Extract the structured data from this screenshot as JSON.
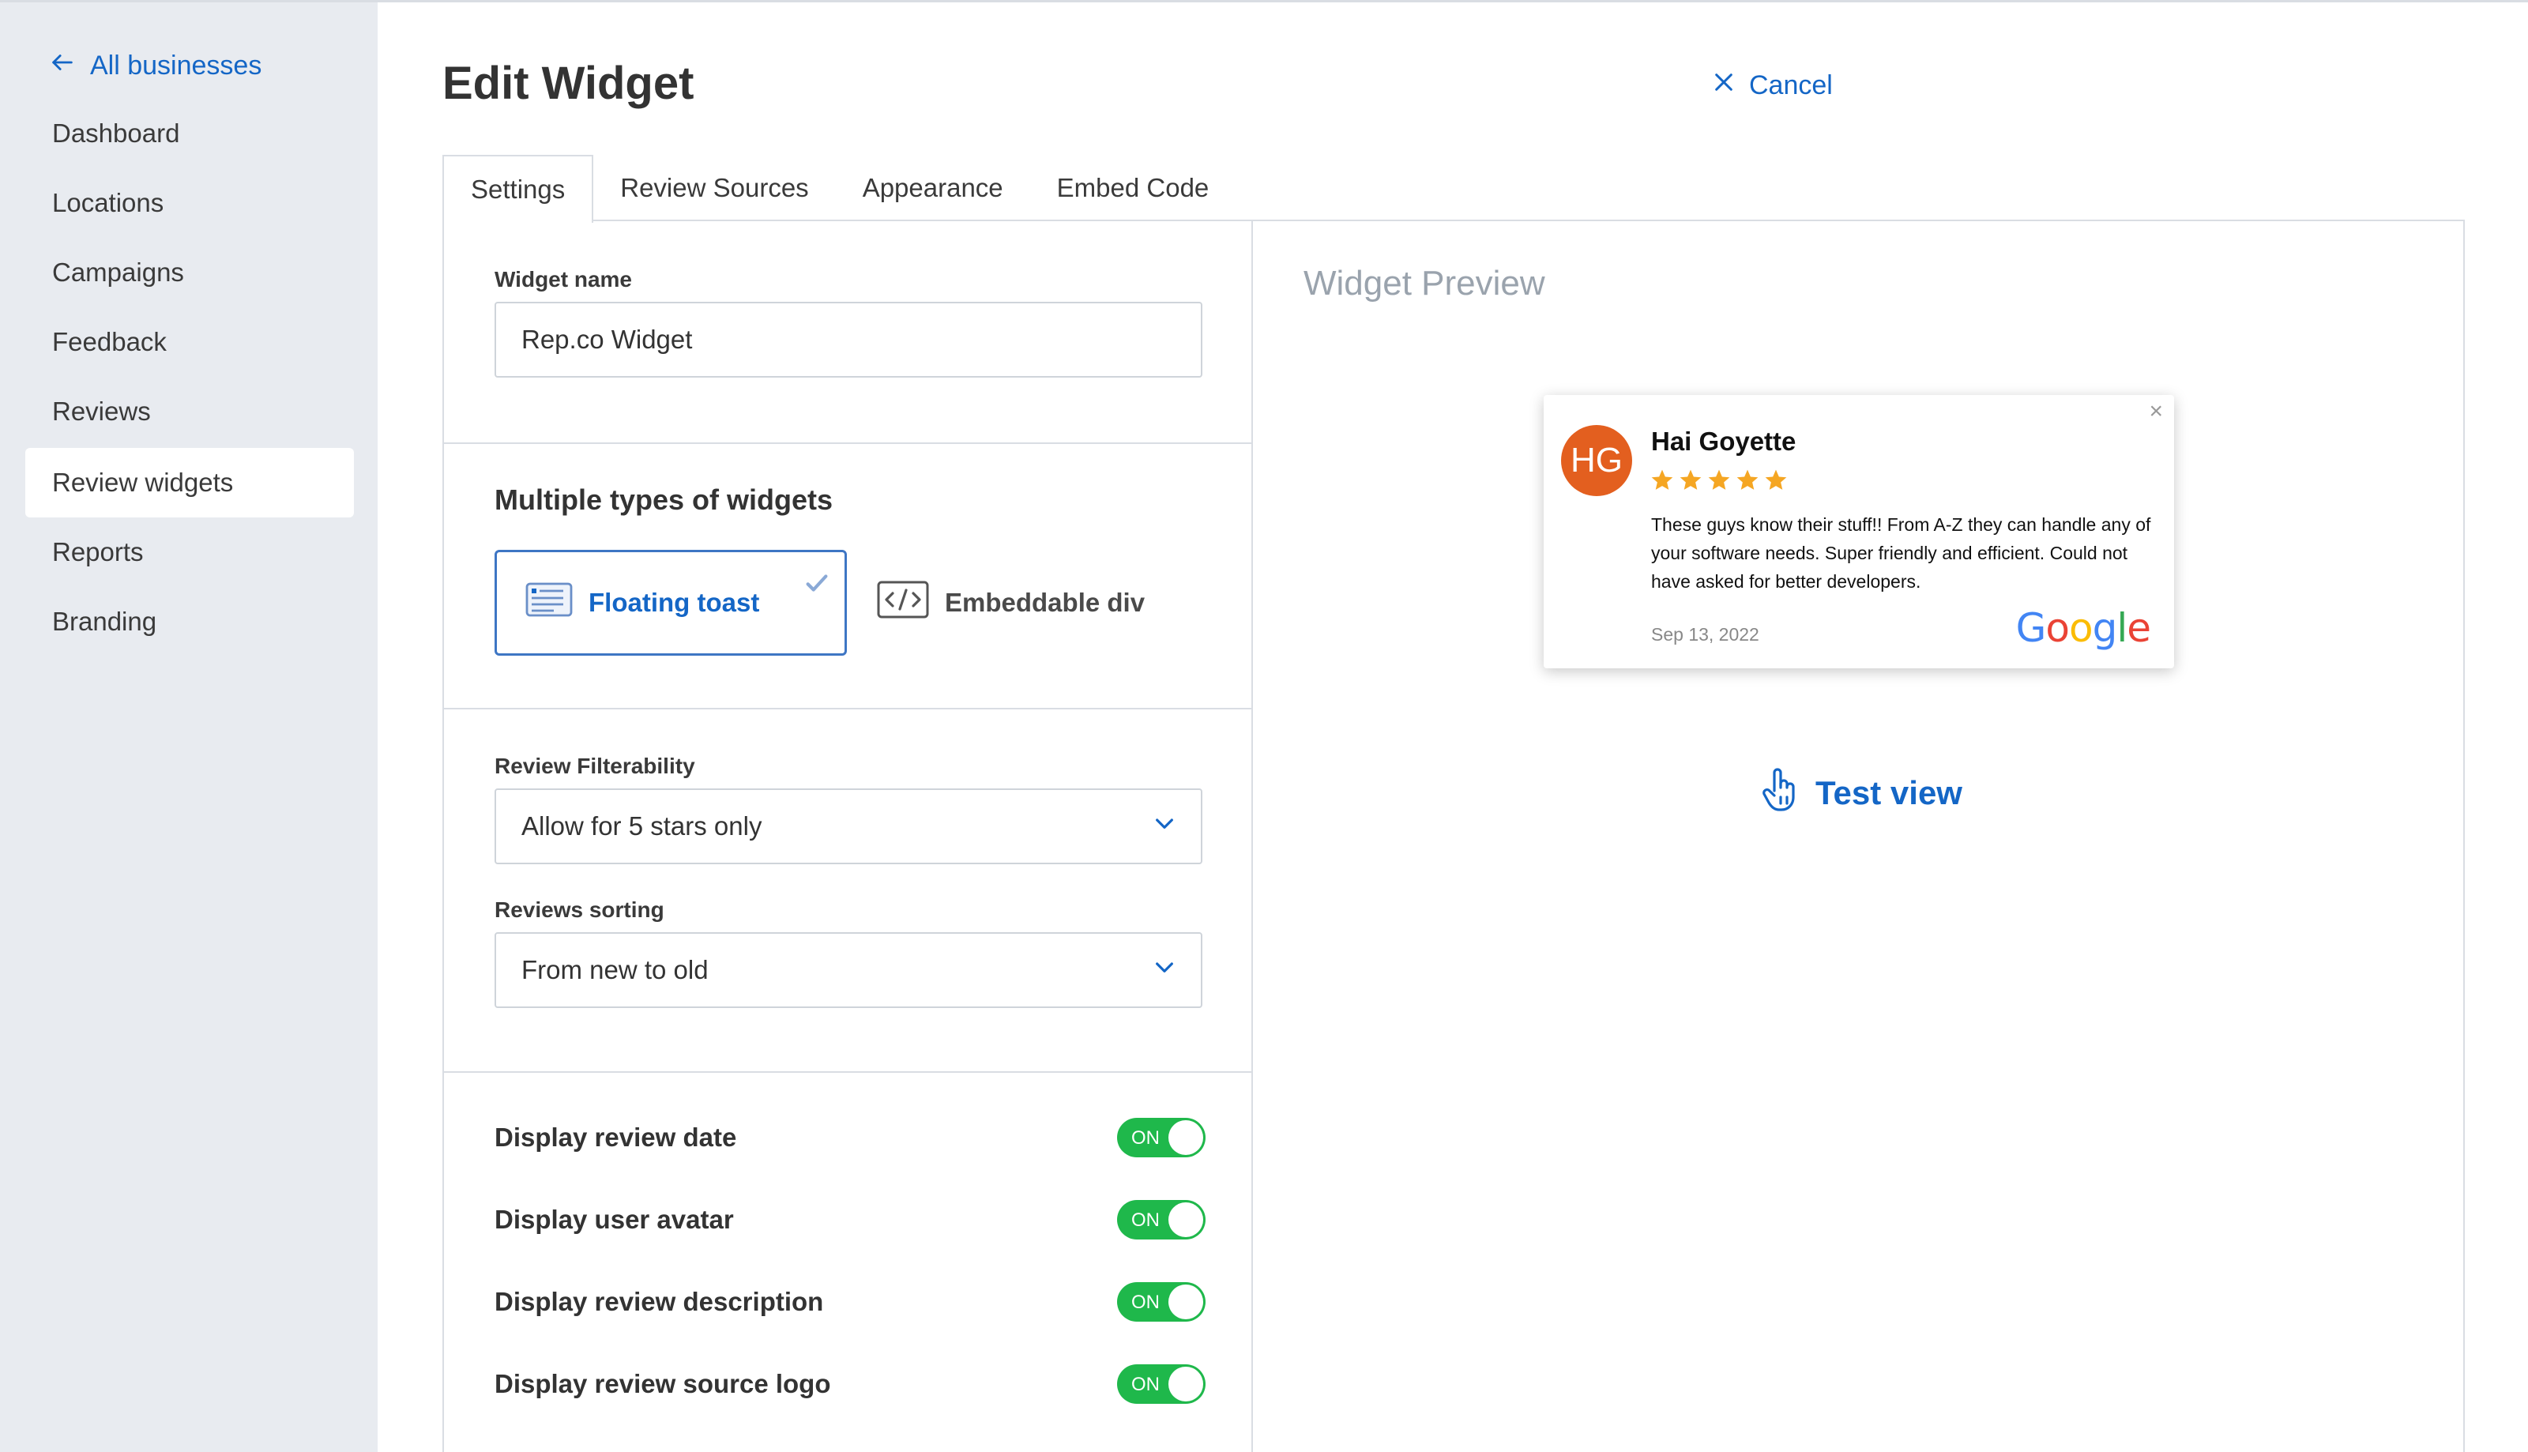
{
  "sidebar": {
    "back_label": "All businesses",
    "items": [
      {
        "label": "Dashboard"
      },
      {
        "label": "Locations"
      },
      {
        "label": "Campaigns"
      },
      {
        "label": "Feedback"
      },
      {
        "label": "Reviews"
      },
      {
        "label": "Review widgets",
        "active": true
      },
      {
        "label": "Reports"
      },
      {
        "label": "Branding"
      }
    ]
  },
  "header": {
    "title": "Edit Widget",
    "cancel_label": "Cancel"
  },
  "tabs": [
    {
      "label": "Settings",
      "active": true
    },
    {
      "label": "Review Sources"
    },
    {
      "label": "Appearance"
    },
    {
      "label": "Embed Code"
    }
  ],
  "settings": {
    "widget_name_label": "Widget name",
    "widget_name_value": "Rep.co Widget",
    "types_title": "Multiple types of widgets",
    "type_selected": "Floating toast",
    "type_other": "Embeddable div",
    "filter_label": "Review Filterability",
    "filter_value": "Allow for 5 stars only",
    "sorting_label": "Reviews sorting",
    "sorting_value": "From new to old",
    "toggles": [
      {
        "label": "Display review date",
        "state": "ON"
      },
      {
        "label": "Display user avatar",
        "state": "ON"
      },
      {
        "label": "Display review description",
        "state": "ON"
      },
      {
        "label": "Display review source logo",
        "state": "ON"
      }
    ]
  },
  "preview": {
    "title": "Widget Preview",
    "close_glyph": "×",
    "review": {
      "initials": "HG",
      "name": "Hai Goyette",
      "rating": 5,
      "text": "These guys know their stuff!! From A-Z they can handle any of your software needs. Super friendly and efficient. Could not have asked for better developers.",
      "date": "Sep 13, 2022",
      "source": [
        "G",
        "o",
        "o",
        "g",
        "l",
        "e"
      ]
    },
    "test_view_label": "Test view"
  },
  "colors": {
    "accent": "#1466c6",
    "toggle_on": "#1fb84b",
    "star": "#f5a623",
    "avatar": "#e35f1f",
    "sidebar_bg": "#e8ebf0",
    "google": [
      "#4285f4",
      "#ea4335",
      "#fbbc05",
      "#4285f4",
      "#34a853",
      "#ea4335"
    ]
  }
}
